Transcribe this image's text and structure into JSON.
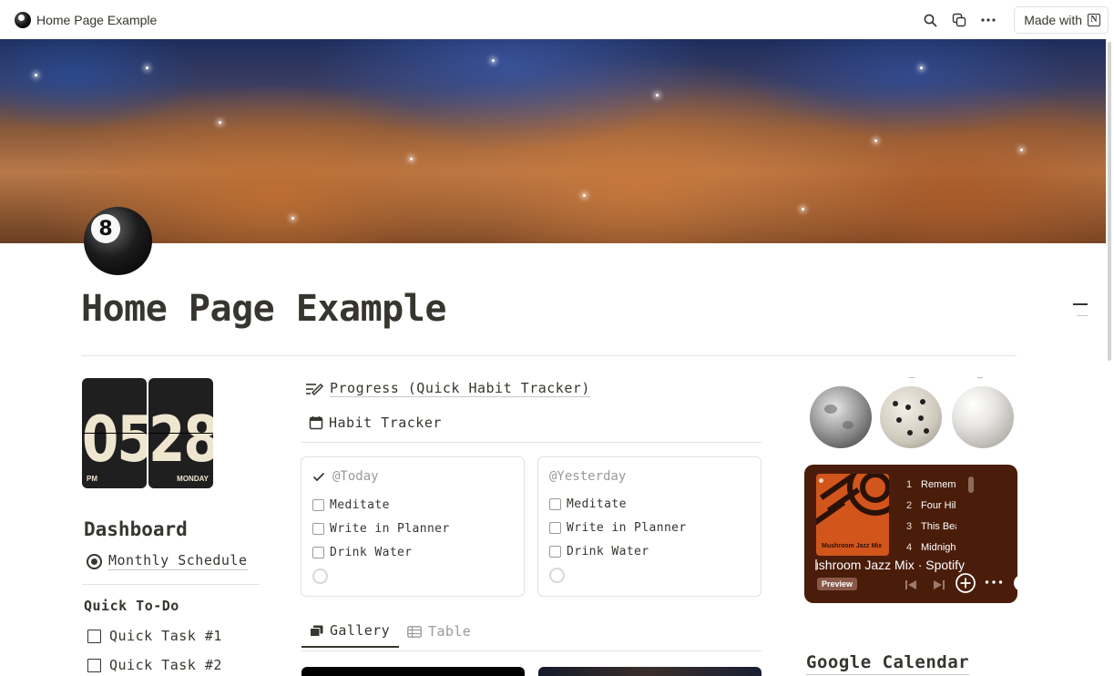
{
  "topbar": {
    "title": "Home Page Example",
    "made_with_label": "Made with",
    "notion_logo": "N",
    "icons": [
      "8-ball-icon",
      "search-icon",
      "duplicate-icon",
      "more-icon",
      "notion-logo-icon"
    ]
  },
  "page": {
    "title": "Home Page Example",
    "icon": "8-ball-icon",
    "icon_glyph": "8",
    "cover": "nebula-cover-image"
  },
  "clock": {
    "hours": "05",
    "minutes": "28",
    "period": "PM",
    "weekday": "MONDAY"
  },
  "sidebar": {
    "dashboard_heading": "Dashboard",
    "monthly_schedule": "Monthly Schedule",
    "quick_todo_heading": "Quick To-Do",
    "tasks": [
      {
        "label": "Quick Task #1",
        "checked": false
      },
      {
        "label": "Quick Task #2",
        "checked": false
      }
    ]
  },
  "middle": {
    "progress_link": "Progress (Quick Habit Tracker)",
    "habit_tracker_link": "Habit Tracker",
    "cards": [
      {
        "title": "@Today",
        "items": [
          {
            "label": "Meditate",
            "checked": false
          },
          {
            "label": "Write in Planner",
            "checked": false
          },
          {
            "label": "Drink Water",
            "checked": false
          }
        ]
      },
      {
        "title": "@Yesterday",
        "items": [
          {
            "label": "Meditate",
            "checked": false
          },
          {
            "label": "Write in Planner",
            "checked": false
          },
          {
            "label": "Drink Water",
            "checked": false
          }
        ]
      }
    ],
    "tabs": [
      {
        "label": "Gallery",
        "active": true
      },
      {
        "label": "Table",
        "active": false
      }
    ]
  },
  "right": {
    "orbs": [
      "moon-image",
      "dice-image",
      "pearl-image"
    ],
    "spotify": {
      "art_label": "Mushroom Jazz Mix",
      "tracks": [
        {
          "n": "1",
          "title": "Remem"
        },
        {
          "n": "2",
          "title": "Four Hil"
        },
        {
          "n": "3",
          "title": "This Bea"
        },
        {
          "n": "4",
          "title": "Midnigh"
        }
      ],
      "playlist_title": "ushroom Jazz Mix · Spotify",
      "preview_label": "Preview",
      "bg_color": "#4a1d0b",
      "art_color": "#d2551b"
    },
    "gcal_heading": "Google Calendar"
  },
  "colors": {
    "text": "#37352f",
    "muted": "#9b9a97",
    "divider": "#e3e2e0",
    "clock_bg": "#1f1f1f",
    "clock_digits": "#efe6cf"
  }
}
